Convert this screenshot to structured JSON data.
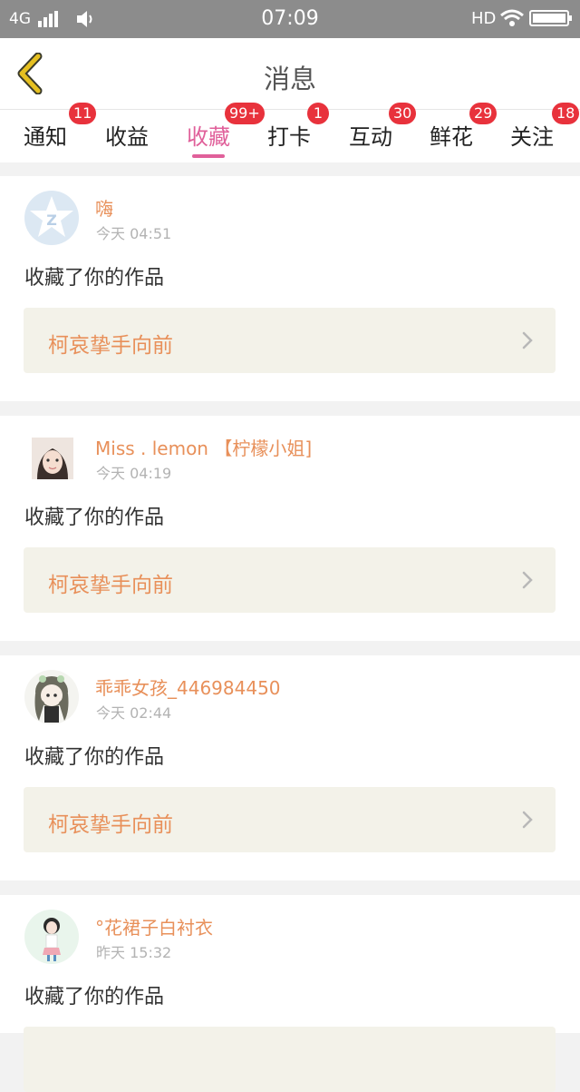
{
  "status_bar": {
    "network": "4G",
    "time": "07:09",
    "hd": "HD"
  },
  "header": {
    "title": "消息"
  },
  "tabs": [
    {
      "label": "通知",
      "badge": "11"
    },
    {
      "label": "收益",
      "badge": ""
    },
    {
      "label": "收藏",
      "badge": "99+"
    },
    {
      "label": "打卡",
      "badge": "1"
    },
    {
      "label": "互动",
      "badge": "30"
    },
    {
      "label": "鲜花",
      "badge": "29"
    },
    {
      "label": "关注",
      "badge": "18"
    }
  ],
  "active_tab": "收藏",
  "messages": [
    {
      "user": "嗨",
      "time": "今天 04:51",
      "action": "收藏了你的作品",
      "work": "柯哀挚手向前"
    },
    {
      "user": "Miss . lemon 【柠檬小姐]",
      "time": "今天 04:19",
      "action": "收藏了你的作品",
      "work": "柯哀挚手向前"
    },
    {
      "user": "乖乖女孩_446984450",
      "time": "今天 02:44",
      "action": "收藏了你的作品",
      "work": "柯哀挚手向前"
    },
    {
      "user": "°花裙子白衬衣",
      "time": "昨天 15:32",
      "action": "收藏了你的作品",
      "work": ""
    }
  ],
  "colors": {
    "accent": "#e0609a",
    "name": "#e8905a",
    "badge": "#e8323c",
    "back_icon": "#e6c020"
  }
}
